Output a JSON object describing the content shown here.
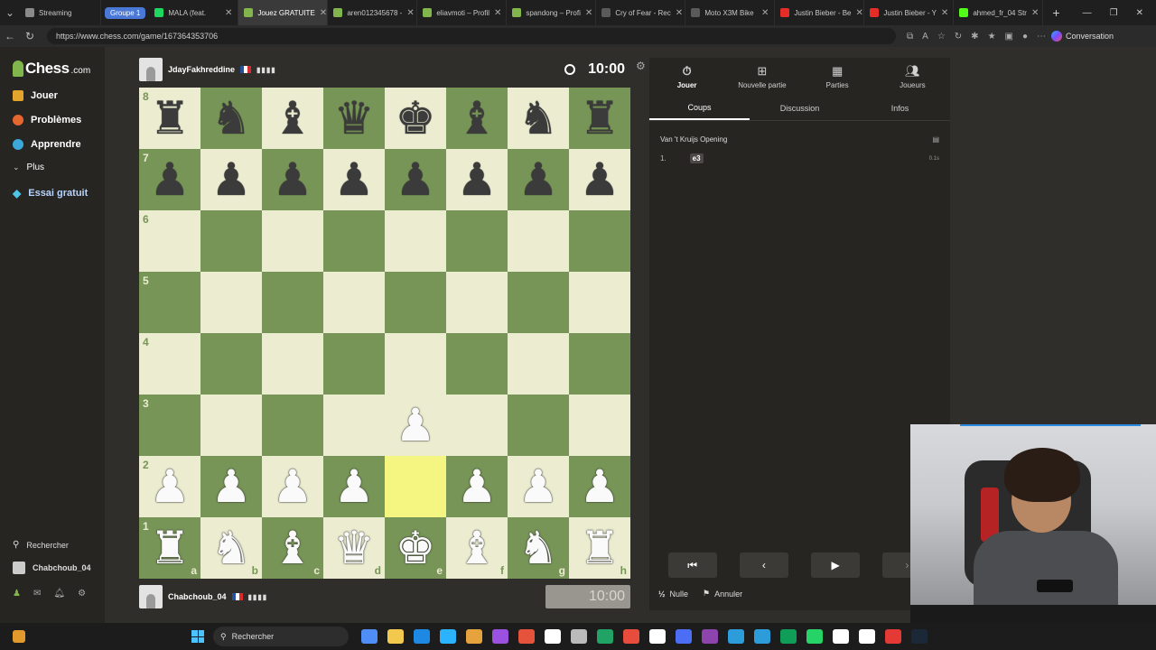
{
  "browser": {
    "tab_group": "Groupe 1",
    "tabs": [
      {
        "label": "Streaming",
        "color": "#8a8a8a",
        "active": false
      },
      {
        "label": "MALA (feat.",
        "color": "#1ed760",
        "active": false
      },
      {
        "label": "Jouez GRATUITE",
        "color": "#81b64c",
        "active": true
      },
      {
        "label": "aren012345678 -",
        "color": "#81b64c",
        "active": false
      },
      {
        "label": "eliavmoti – Profil",
        "color": "#81b64c",
        "active": false
      },
      {
        "label": "spandong – Profi",
        "color": "#81b64c",
        "active": false
      },
      {
        "label": "Cry of Fear - Rec",
        "color": "#5a5a5a",
        "active": false
      },
      {
        "label": "Moto X3M Bike",
        "color": "#5a5a5a",
        "active": false
      },
      {
        "label": "Justin Bieber - Be",
        "color": "#e52d27",
        "active": false
      },
      {
        "label": "Justin Bieber - Y",
        "color": "#e52d27",
        "active": false
      },
      {
        "label": "ahmed_fr_04 Str",
        "color": "#53fc18",
        "active": false
      }
    ],
    "url": "https://www.chess.com/game/167364353706",
    "copilot_label": "Conversation"
  },
  "sidebar": {
    "logo": "Chess",
    "logo_suffix": ".com",
    "items": [
      {
        "label": "Jouer",
        "color": "#e3a42b"
      },
      {
        "label": "Problèmes",
        "color": "#e5662f"
      },
      {
        "label": "Apprendre",
        "color": "#3aa8d8"
      },
      {
        "label": "Plus",
        "color": ""
      },
      {
        "label": "Essai gratuit",
        "color": "#4dc3e6"
      }
    ],
    "search_label": "Rechercher",
    "user_label": "Chabchoub_04"
  },
  "game": {
    "opponent": {
      "name": "JdayFakhreddine",
      "clock": "10:00"
    },
    "player": {
      "name": "Chabchoub_04",
      "clock": "10:00"
    },
    "rank_labels": [
      "8",
      "7",
      "6",
      "5",
      "4",
      "3",
      "2",
      "1"
    ],
    "file_labels": [
      "a",
      "b",
      "c",
      "d",
      "e",
      "f",
      "g",
      "h"
    ],
    "position": [
      [
        "br",
        "bn",
        "bb",
        "bq",
        "bk",
        "bb",
        "bn",
        "br"
      ],
      [
        "bp",
        "bp",
        "bp",
        "bp",
        "bp",
        "bp",
        "bp",
        "bp"
      ],
      [
        "",
        "",
        "",
        "",
        "",
        "",
        "",
        ""
      ],
      [
        "",
        "",
        "",
        "",
        "",
        "",
        "",
        ""
      ],
      [
        "",
        "",
        "",
        "",
        "",
        "",
        "",
        ""
      ],
      [
        "",
        "",
        "",
        "",
        "wp",
        "",
        "",
        ""
      ],
      [
        "wp",
        "wp",
        "wp",
        "wp",
        "",
        "wp",
        "wp",
        "wp"
      ],
      [
        "wr",
        "wn",
        "wb",
        "wq",
        "wk",
        "wb",
        "wn",
        "wr"
      ]
    ],
    "highlight_squares": [
      "e3",
      "e2"
    ]
  },
  "panel": {
    "tabs": [
      {
        "label": "Jouer",
        "icon": "stopwatch-icon"
      },
      {
        "label": "Nouvelle partie",
        "icon": "plus-icon"
      },
      {
        "label": "Parties",
        "icon": "board-icon"
      },
      {
        "label": "Joueurs",
        "icon": "players-icon"
      }
    ],
    "subtabs": [
      "Coups",
      "Discussion",
      "Infos"
    ],
    "opening": "Van 't Kruijs Opening",
    "moves": [
      {
        "number": "1.",
        "white": "e3",
        "time": "0.1s"
      }
    ],
    "draw_label": "Nulle",
    "abort_label": "Annuler",
    "draw_glyph": "½"
  },
  "taskbar": {
    "search_label": "Rechercher",
    "apps": [
      "#4f8ef7",
      "#f2c94c",
      "#1e88e5",
      "#2bb3ff",
      "#e6a23c",
      "#9b51e0",
      "#e5533d",
      "#ffffff",
      "#bbbbbb",
      "#21a366",
      "#e74c3c",
      "#ffffff",
      "#4c6ef5",
      "#8e44ad",
      "#2d9cdb",
      "#2d9cdb",
      "#0f9d58",
      "#25d366",
      "#ffffff",
      "#ffffff",
      "#e53935",
      "#1b2838"
    ]
  }
}
